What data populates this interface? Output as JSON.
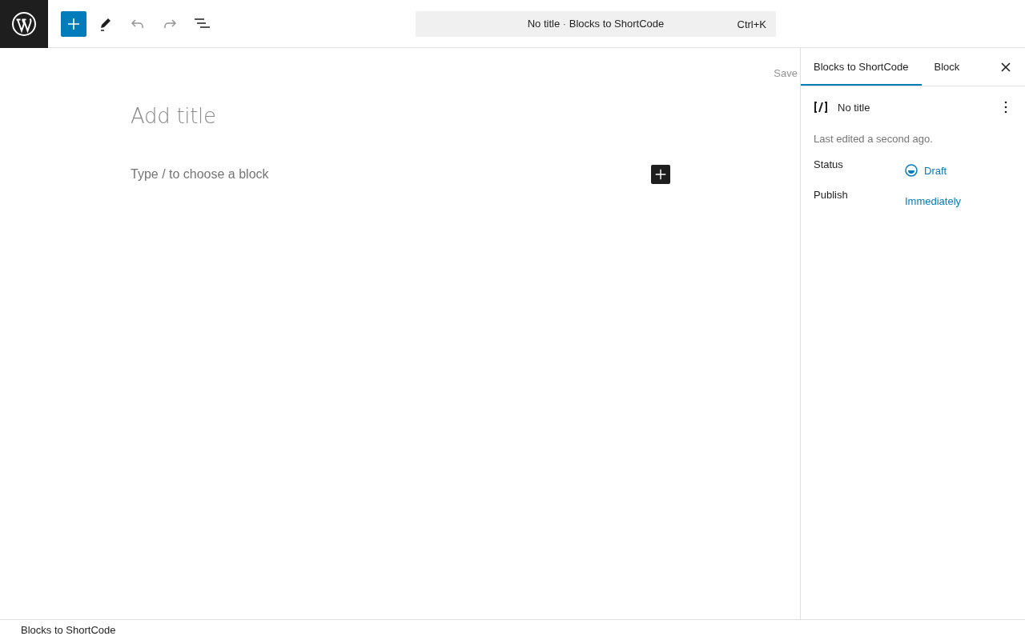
{
  "toolbar": {
    "command_bar": {
      "title": "No title",
      "separator": "·",
      "context": "Blocks to ShortCode",
      "shortcut": "Ctrl+K"
    }
  },
  "editor": {
    "save_label": "Save",
    "title_placeholder": "Add title",
    "block_placeholder": "Type / to choose a block"
  },
  "sidebar": {
    "tabs": [
      {
        "label": "Blocks to ShortCode",
        "selected": true
      },
      {
        "label": "Block",
        "selected": false
      }
    ],
    "post": {
      "title": "No title",
      "last_edited": "Last edited a second ago."
    },
    "fields": [
      {
        "label": "Status",
        "value": "Draft",
        "kind": "status"
      },
      {
        "label": "Publish",
        "value": "Immediately",
        "kind": "plain"
      }
    ]
  },
  "footer": {
    "breadcrumb": "Blocks to ShortCode"
  }
}
